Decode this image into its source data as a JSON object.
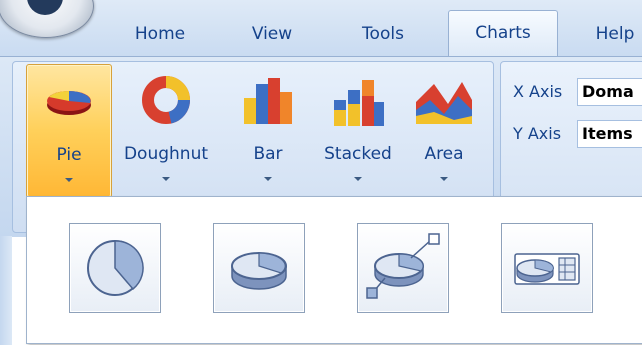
{
  "tabs": [
    {
      "label": "Home",
      "active": false
    },
    {
      "label": "View",
      "active": false
    },
    {
      "label": "Tools",
      "active": false
    },
    {
      "label": "Charts",
      "active": true
    },
    {
      "label": "Help",
      "active": false
    }
  ],
  "chart_buttons": [
    {
      "label": "Pie",
      "selected": true,
      "icon": "pie-chart-icon"
    },
    {
      "label": "Doughnut",
      "selected": false,
      "icon": "doughnut-chart-icon"
    },
    {
      "label": "Bar",
      "selected": false,
      "icon": "bar-chart-icon"
    },
    {
      "label": "Stacked",
      "selected": false,
      "icon": "stacked-chart-icon"
    },
    {
      "label": "Area",
      "selected": false,
      "icon": "area-chart-icon"
    }
  ],
  "axes": {
    "x_label": "X Axis",
    "x_value": "Doma",
    "y_label": "Y Axis",
    "y_value": "Items"
  },
  "gallery_items": [
    {
      "icon": "pie-2d-icon"
    },
    {
      "icon": "pie-3d-icon"
    },
    {
      "icon": "pie-3d-exploded-callout-icon"
    },
    {
      "icon": "pie-3d-legend-icon"
    }
  ],
  "colors": {
    "selected_start": "#ffe6a0",
    "selected_end": "#ffb735",
    "tab_text": "#15428b",
    "pie_blue": "#5b7fc0"
  }
}
